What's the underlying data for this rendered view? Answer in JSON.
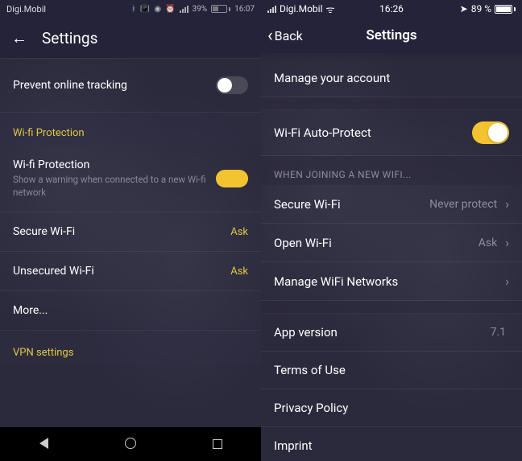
{
  "left": {
    "status": {
      "carrier": "Digi.Mobil",
      "battery_pct": "39%",
      "time": "16:07"
    },
    "header": {
      "title": "Settings"
    },
    "prevent_tracking": {
      "label": "Prevent online tracking",
      "state": "off"
    },
    "section_wifi": "Wi-fi Protection",
    "wifi_protection": {
      "label": "Wi-fi Protection",
      "sub": "Show a warning when connected to a new Wi-fi network",
      "state": "on"
    },
    "secure_wifi": {
      "label": "Secure Wi-Fi",
      "value": "Ask"
    },
    "unsecured_wifi": {
      "label": "Unsecured Wi-Fi",
      "value": "Ask"
    },
    "more": {
      "label": "More..."
    },
    "section_vpn": "VPN settings"
  },
  "right": {
    "status": {
      "carrier": "Digi.Mobil",
      "time": "16:26",
      "battery_pct": "89 %"
    },
    "header": {
      "back": "Back",
      "title": "Settings"
    },
    "manage_account": {
      "label": "Manage your account"
    },
    "wifi_auto_protect": {
      "label": "Wi-Fi Auto-Protect",
      "state": "on"
    },
    "section_when_joining": "WHEN JOINING A NEW WIFI...",
    "secure_wifi": {
      "label": "Secure Wi-Fi",
      "value": "Never protect"
    },
    "open_wifi": {
      "label": "Open Wi-Fi",
      "value": "Ask"
    },
    "manage_networks": {
      "label": "Manage WiFi Networks"
    },
    "app_version": {
      "label": "App version",
      "value": "7.1"
    },
    "terms": {
      "label": "Terms of Use"
    },
    "privacy": {
      "label": "Privacy Policy"
    },
    "imprint": {
      "label": "Imprint"
    }
  }
}
